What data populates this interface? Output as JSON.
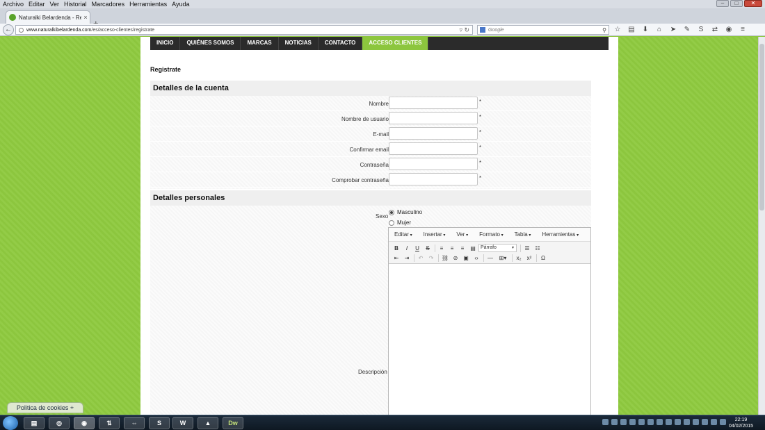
{
  "browser": {
    "menu": [
      "Archivo",
      "Editar",
      "Ver",
      "Historial",
      "Marcadores",
      "Herramientas",
      "Ayuda"
    ],
    "tab_title": "Naturalki Belardenda - Reg...",
    "tab_close": "×",
    "new_tab": "+",
    "url_domain": "www.naturalkibelardenda.com",
    "url_path": "/es/acceso-clientes/registrate",
    "search_placeholder": "Google"
  },
  "nav": {
    "items": [
      "INICIO",
      "QUIÉNES SOMOS",
      "MARCAS",
      "NOTICIAS",
      "CONTACTO",
      "ACCESO CLIENTES"
    ],
    "active_index": 5
  },
  "page_title": "Registrate",
  "account": {
    "heading": "Detalles de la cuenta",
    "fields": [
      {
        "label": "Nombre",
        "value": "",
        "required": "*"
      },
      {
        "label": "Nombre de usuario",
        "value": "",
        "required": "*"
      },
      {
        "label": "E-mail",
        "value": "",
        "required": "*"
      },
      {
        "label": "Confirmar email",
        "value": "",
        "required": "*"
      },
      {
        "label": "Contraseña",
        "value": "",
        "required": "*"
      },
      {
        "label": "Comprobar contraseña",
        "value": "",
        "required": "*"
      }
    ]
  },
  "personal": {
    "heading": "Detalles personales",
    "sexo_label": "Sexo",
    "options": [
      {
        "label": "Masculino",
        "checked": true
      },
      {
        "label": "Mujer",
        "checked": false
      }
    ],
    "description_label": "Descripción"
  },
  "editor": {
    "menus": [
      "Editar",
      "Insertar",
      "Ver",
      "Formato",
      "Tabla",
      "Herramientas"
    ],
    "format_select": "Párrafo"
  },
  "cookies_label": "Politica de cookies +",
  "taskbar": {
    "dw_label": "Dw",
    "w_label": "W",
    "clock_time": "22:19",
    "clock_date": "04/02/2015"
  },
  "colors": {
    "accent_green": "#8cc63e",
    "nav_dark": "#2b2b2b"
  }
}
